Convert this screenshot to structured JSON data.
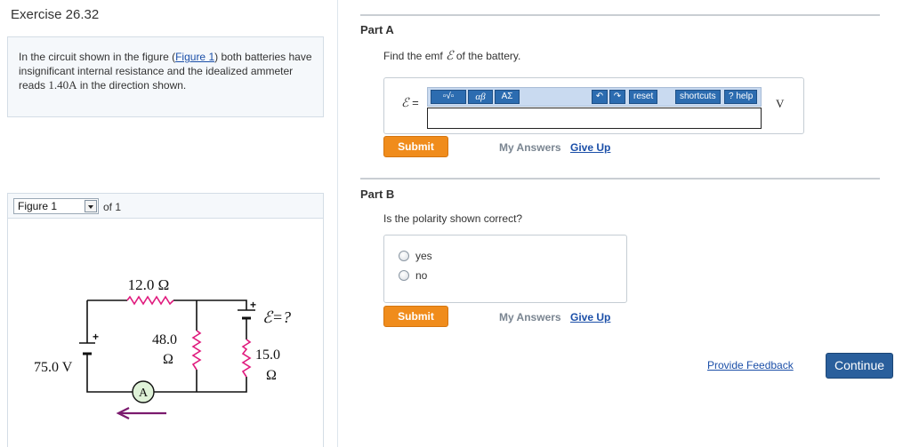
{
  "exercise": {
    "title": "Exercise 26.32",
    "problem": {
      "text_before": "In the circuit shown in the figure (",
      "figure_link": "Figure 1",
      "text_middle": ") both batteries have insignificant internal resistance and the idealized ammeter reads ",
      "reading": "1.40",
      "reading_unit": "A",
      "text_after": " in the direction shown."
    }
  },
  "figure": {
    "selected": "Figure 1",
    "of_text": "of 1",
    "labels": {
      "r_top": "12.0 Ω",
      "r_mid_value": "48.0",
      "r_mid_unit": "Ω",
      "r_right_value": "15.0",
      "r_right_unit": "Ω",
      "battery_left": "75.0 V",
      "battery_right": "ℰ=?",
      "plus": "+",
      "ammeter": "A"
    },
    "colors": {
      "resistor": "#e0197d",
      "arrow": "#7b1a6e",
      "ammeter_fill": "#dff2d8"
    }
  },
  "partA": {
    "label": "Part A",
    "question_before": "Find the emf ",
    "question_symbol": "ℰ",
    "question_after": " of the battery.",
    "eq_symbol": "ℰ",
    "eq_sign": " =",
    "toolbar": {
      "templates": "▫√▫",
      "greek": "αβ",
      "symbols": "ΑΣ",
      "undo_icon": "↶",
      "redo_icon": "↷",
      "reset": "reset",
      "shortcuts": "shortcuts",
      "help": "help",
      "help_q": "?"
    },
    "input_value": "",
    "unit": "V",
    "submit": "Submit",
    "my_answers": "My Answers",
    "give_up": "Give Up"
  },
  "partB": {
    "label": "Part B",
    "question": "Is the polarity shown correct?",
    "options": [
      "yes",
      "no"
    ],
    "submit": "Submit",
    "my_answers": "My Answers",
    "give_up": "Give Up"
  },
  "footer": {
    "feedback": "Provide Feedback",
    "continue": "Continue"
  }
}
